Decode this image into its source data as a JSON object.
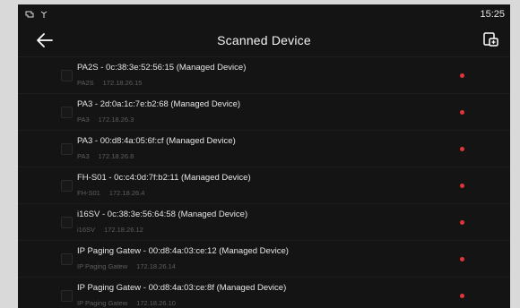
{
  "status_bar": {
    "time": "15:25",
    "left_icons": [
      "usb-icon",
      "network-icon"
    ]
  },
  "header": {
    "title": "Scanned Device",
    "back_icon": "back-arrow-icon",
    "action_icon": "device-export-icon"
  },
  "devices": [
    {
      "name": "PA2S - 0c:38:3e:52:56:15 (Managed Device)",
      "model": "PA2S",
      "ip": "172.18.26.15",
      "status_color": "#e3343a"
    },
    {
      "name": "PA3 - 2d:0a:1c:7e:b2:68 (Managed Device)",
      "model": "PA3",
      "ip": "172.18.26.3",
      "status_color": "#e3343a"
    },
    {
      "name": "PA3 - 00:d8:4a:05:6f:cf (Managed Device)",
      "model": "PA3",
      "ip": "172.18.26.8",
      "status_color": "#e3343a"
    },
    {
      "name": "FH-S01 - 0c:c4:0d:7f:b2:11 (Managed Device)",
      "model": "FH-S01",
      "ip": "172.18.26.4",
      "status_color": "#e3343a"
    },
    {
      "name": "i16SV - 0c:38:3e:56:64:58 (Managed Device)",
      "model": "i16SV",
      "ip": "172.18.26.12",
      "status_color": "#e3343a"
    },
    {
      "name": "IP Paging Gatew - 00:d8:4a:03:ce:12 (Managed Device)",
      "model": "IP Paging Gatew",
      "ip": "172.18.26.14",
      "status_color": "#e3343a"
    },
    {
      "name": "IP Paging Gatew - 00:d8:4a:03:ce:8f (Managed Device)",
      "model": "IP Paging Gatew",
      "ip": "172.18.26.10",
      "status_color": "#e3343a"
    }
  ]
}
